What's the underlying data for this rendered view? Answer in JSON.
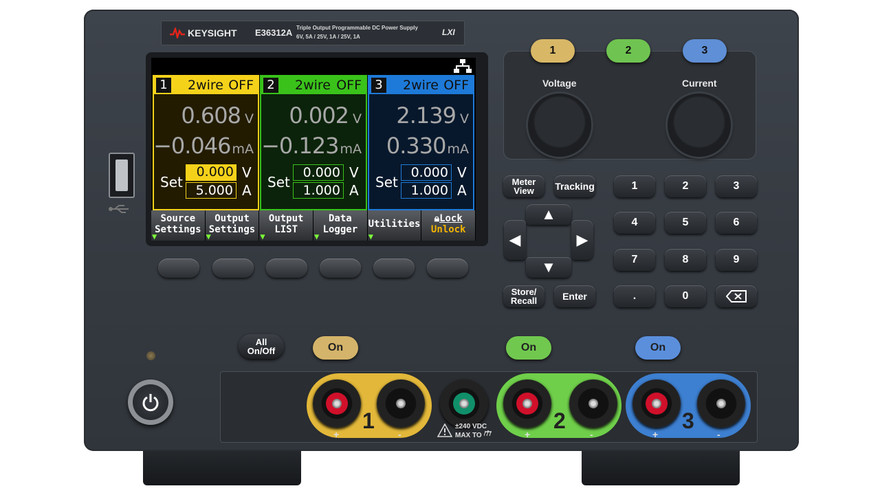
{
  "brand": {
    "logo": "KEYSIGHT",
    "model": "E36312A",
    "description_line1": "Triple Output Programmable DC Power Supply",
    "description_line2": "6V, 5A / 25V, 1A / 25V, 1A",
    "lxi": "LXI"
  },
  "screen": {
    "channels": [
      {
        "num": "1",
        "mode": "2wire",
        "state": "OFF",
        "voltage": "0.608",
        "voltage_unit": "V",
        "current": "−0.046",
        "current_unit": "mA",
        "set_label": "Set",
        "set_voltage": "0.000",
        "set_voltage_unit": "V",
        "set_current": "5.000",
        "set_current_unit": "A",
        "color": "#f5d21a"
      },
      {
        "num": "2",
        "mode": "2wire",
        "state": "OFF",
        "voltage": "0.002",
        "voltage_unit": "V",
        "current": "−0.123",
        "current_unit": "mA",
        "set_label": "Set",
        "set_voltage": "0.000",
        "set_voltage_unit": "V",
        "set_current": "1.000",
        "set_current_unit": "A",
        "color": "#3ac21a"
      },
      {
        "num": "3",
        "mode": "2wire",
        "state": "OFF",
        "voltage": "2.139",
        "voltage_unit": "V",
        "current": "0.330",
        "current_unit": "mA",
        "set_label": "Set",
        "set_voltage": "0.000",
        "set_voltage_unit": "V",
        "set_current": "1.000",
        "set_current_unit": "A",
        "color": "#1e7ad8"
      }
    ],
    "softkeys": [
      {
        "line1": "Source",
        "line2": "Settings"
      },
      {
        "line1": "Output",
        "line2": "Settings"
      },
      {
        "line1": "Output",
        "line2": "LIST"
      },
      {
        "line1": "Data",
        "line2": "Logger"
      },
      {
        "line1": "Utilities",
        "line2": ""
      },
      {
        "line1": "Lock",
        "line2": "Unlock"
      }
    ]
  },
  "controls": {
    "channel_buttons": [
      "1",
      "2",
      "3"
    ],
    "voltage_label": "Voltage",
    "current_label": "Current",
    "meter_view": [
      "Meter",
      "View"
    ],
    "tracking": "Tracking",
    "store_recall": [
      "Store/",
      "Recall"
    ],
    "enter": "Enter",
    "keypad": [
      "1",
      "2",
      "3",
      "4",
      "5",
      "6",
      "7",
      "8",
      "9",
      ".",
      "0"
    ],
    "all_onoff": [
      "All",
      "On/Off"
    ],
    "on_label": "On"
  },
  "terminals": {
    "numbers": [
      "1",
      "2",
      "3"
    ],
    "plus": "+",
    "minus": "-",
    "warning_line1": "±240 VDC",
    "warning_line2": "MAX TO"
  },
  "colors": {
    "ch1": "#d8b867",
    "ch2": "#6fc451",
    "ch3": "#5f8fd6",
    "ch1_term": "#e3b83a",
    "ch2_term": "#6fcf4a",
    "ch3_term": "#3d7fd0"
  }
}
